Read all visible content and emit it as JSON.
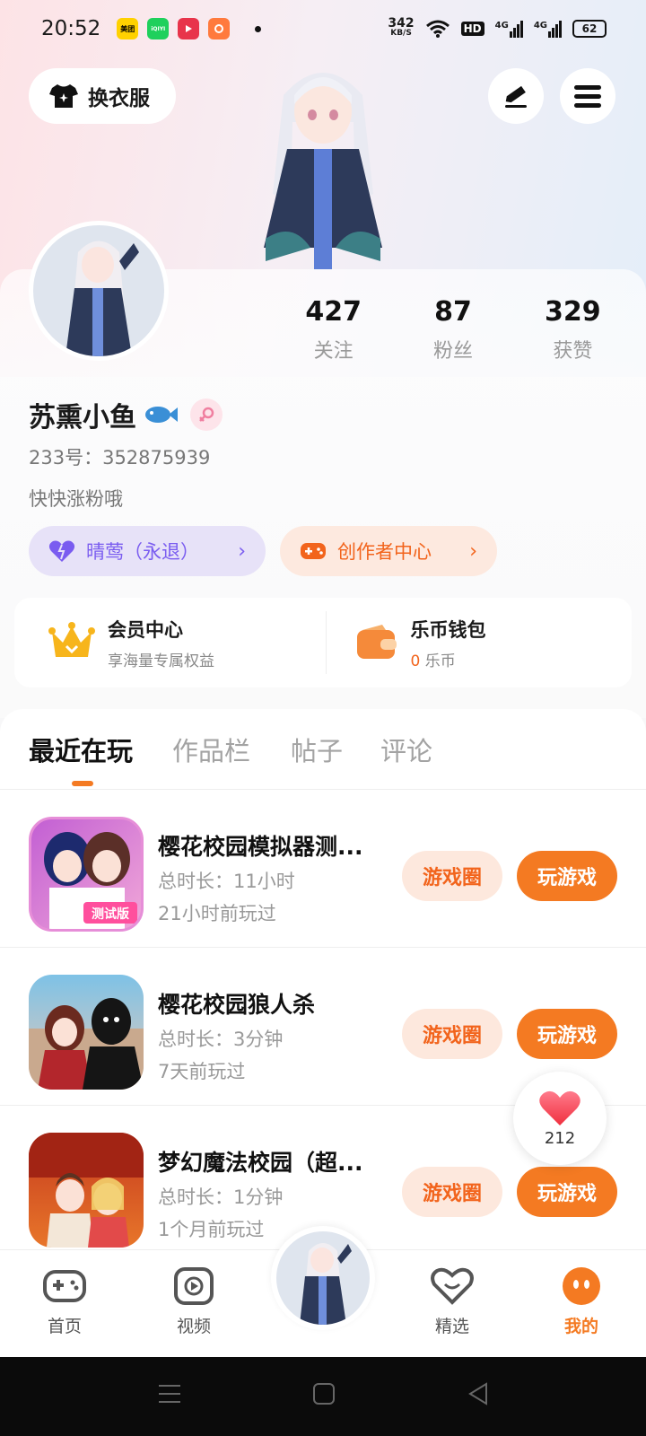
{
  "status_bar": {
    "time": "20:52",
    "net_speed_value": "342",
    "net_speed_unit": "KB/S",
    "hd_label": "HD",
    "net_4g_1": "4G",
    "net_4g_2": "4G",
    "battery": "62",
    "app_icon_meituan": "美团",
    "app_icon_iqiyi": "iQIYI"
  },
  "header": {
    "outfit_label": "换衣服"
  },
  "profile": {
    "stats": [
      {
        "value": "427",
        "label": "关注"
      },
      {
        "value": "87",
        "label": "粉丝"
      },
      {
        "value": "329",
        "label": "获赞"
      }
    ],
    "username": "苏熏小鱼",
    "uid": "233号：352875939",
    "bio": "快快涨粉哦",
    "level_pill": "晴莺（永退）",
    "creator_pill": "创作者中心"
  },
  "member": {
    "vip_title": "会员中心",
    "vip_sub": "享海量专属权益",
    "wallet_title": "乐币钱包",
    "wallet_amount": "0",
    "wallet_unit": "乐币"
  },
  "tabs": [
    "最近在玩",
    "作品栏",
    "帖子",
    "评论"
  ],
  "games": [
    {
      "title": "樱花校园模拟器测...",
      "duration": "总时长：11小时",
      "last_played": "21小时前玩过",
      "circle_label": "游戏圈",
      "play_label": "玩游戏",
      "icon_badge": "测试版"
    },
    {
      "title": "樱花校园狼人杀",
      "duration": "总时长：3分钟",
      "last_played": "7天前玩过",
      "circle_label": "游戏圈",
      "play_label": "玩游戏"
    },
    {
      "title": "梦幻魔法校园（超...",
      "duration": "总时长：1分钟",
      "last_played": "1个月前玩过",
      "circle_label": "游戏圈",
      "play_label": "玩游戏"
    }
  ],
  "like_float": {
    "count": "212"
  },
  "bottom_nav": [
    {
      "label": "首页"
    },
    {
      "label": "视频"
    },
    {
      "label": "精选"
    },
    {
      "label": "我的"
    }
  ],
  "colors": {
    "accent": "#f47a22",
    "purple": "#7a5cf0"
  }
}
